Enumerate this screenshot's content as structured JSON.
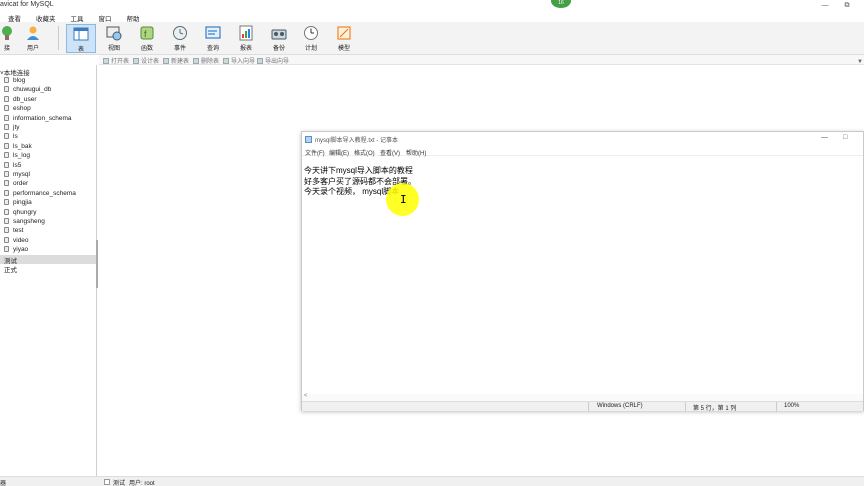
{
  "window": {
    "title": "avicat for MySQL",
    "badge": "16"
  },
  "menu": [
    "查看",
    "收藏夹",
    "工具",
    "窗口",
    "帮助"
  ],
  "toolbar": [
    {
      "label": "接",
      "icon": "connection-icon"
    },
    {
      "label": "用户",
      "icon": "user-icon"
    },
    {
      "label": "表",
      "icon": "table-icon",
      "active": true
    },
    {
      "label": "视图",
      "icon": "view-icon"
    },
    {
      "label": "函数",
      "icon": "function-icon"
    },
    {
      "label": "事件",
      "icon": "event-icon"
    },
    {
      "label": "查询",
      "icon": "query-icon"
    },
    {
      "label": "报表",
      "icon": "report-icon"
    },
    {
      "label": "备份",
      "icon": "backup-icon"
    },
    {
      "label": "计划",
      "icon": "schedule-icon"
    },
    {
      "label": "模型",
      "icon": "model-icon"
    }
  ],
  "subtoolbar": [
    "打开表",
    "设计表",
    "新建表",
    "删除表",
    "导入向导",
    "导出向导"
  ],
  "sidebar": {
    "connection": "本地连接",
    "databases": [
      "blog",
      "chuwugui_db",
      "db_user",
      "eshop",
      "information_schema",
      "jty",
      "ls",
      "ls_bak",
      "ls_log",
      "ls5",
      "mysql",
      "order",
      "performance_schema",
      "pingjia",
      "qhungry",
      "sangsheng",
      "test",
      "video",
      "yiyao"
    ],
    "connections": [
      {
        "label": "测试",
        "selected": true
      },
      {
        "label": "正式",
        "selected": false
      }
    ]
  },
  "statusbar": {
    "left": "器",
    "connection": "测试",
    "user": "用户: root"
  },
  "notepad": {
    "title": "mysql脚本导入教程.txt - 记事本",
    "menu": [
      "文件(F)",
      "编辑(E)",
      "格式(O)",
      "查看(V)",
      "帮助(H)"
    ],
    "lines": [
      "今天讲下mysql导入脚本的教程",
      "好多客户买了源码都不会部署。",
      "今天录个视频， mysql脚本"
    ],
    "status": {
      "encoding": "Windows (CRLF)",
      "position": "第 5 行，第 1 列",
      "zoom": "100%"
    }
  },
  "colors": {
    "accent": "#cde3f7",
    "badge": "#43a047",
    "cursor_highlight": "#ffff00"
  }
}
